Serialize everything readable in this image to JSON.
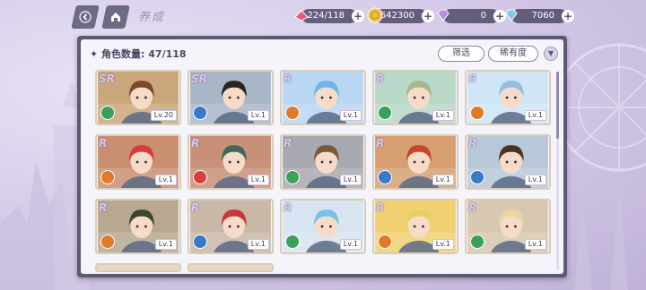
{
  "header": {
    "title": "养成"
  },
  "resources": {
    "stamina": "224/118",
    "gold": "642300",
    "gems_purple": "0",
    "gems_blue": "7060",
    "colors": {
      "stamina": "#e25c7a",
      "gold": "#f0c040",
      "purple": "#b58ee6",
      "blue": "#7fc8ee"
    }
  },
  "panel": {
    "count_label": "角色数量: 47/118",
    "filter_label": "筛选",
    "sort_label": "稀有度"
  },
  "cards": [
    {
      "rarity": "SR",
      "level": "Lv.20",
      "element": "green",
      "bg": "#c9a77a",
      "hair": "#7a4a2a"
    },
    {
      "rarity": "SR",
      "level": "Lv.1",
      "element": "blue",
      "bg": "#a8b6c8",
      "hair": "#2b2520"
    },
    {
      "rarity": "R",
      "level": "Lv.1",
      "element": "orange",
      "bg": "#b9d6f2",
      "hair": "#6bb7ea"
    },
    {
      "rarity": "R",
      "level": "Lv.1",
      "element": "green",
      "bg": "#b8d8c8",
      "hair": "#a9b88c"
    },
    {
      "rarity": "R",
      "level": "Lv.1",
      "element": "orange",
      "bg": "#cfe6f6",
      "hair": "#8fbfe0"
    },
    {
      "rarity": "R",
      "level": "Lv.1",
      "element": "orange",
      "bg": "#c88f70",
      "hair": "#d83a40"
    },
    {
      "rarity": "R",
      "level": "Lv.1",
      "element": "red",
      "bg": "#c89078",
      "hair": "#3f6a5a"
    },
    {
      "rarity": "R",
      "level": "Lv.1",
      "element": "green",
      "bg": "#a8a8b0",
      "hair": "#7a5838"
    },
    {
      "rarity": "R",
      "level": "Lv.1",
      "element": "blue",
      "bg": "#d6a070",
      "hair": "#c8442a"
    },
    {
      "rarity": "R",
      "level": "Lv.1",
      "element": "blue",
      "bg": "#b8c8d8",
      "hair": "#4a3428"
    },
    {
      "rarity": "R",
      "level": "Lv.1",
      "element": "orange",
      "bg": "#b8a890",
      "hair": "#3a4830"
    },
    {
      "rarity": "R",
      "level": "Lv.1",
      "element": "blue",
      "bg": "#c8b8a8",
      "hair": "#c83838"
    },
    {
      "rarity": "R",
      "level": "Lv.1",
      "element": "green",
      "bg": "#d8e4f0",
      "hair": "#74c2ea"
    },
    {
      "rarity": "R",
      "level": "Lv.1",
      "element": "orange",
      "bg": "#f0d070",
      "hair": "#e8d060"
    },
    {
      "rarity": "R",
      "level": "Lv.1",
      "element": "green",
      "bg": "#d8c8b0",
      "hair": "#e8d8a0"
    }
  ],
  "element_colors": {
    "green": "#3aa05a",
    "blue": "#3a78c8",
    "orange": "#e07a2a",
    "red": "#d84040"
  },
  "scroll": {
    "thumb_fraction_start": 0.0,
    "thumb_fraction_size": 0.34
  }
}
